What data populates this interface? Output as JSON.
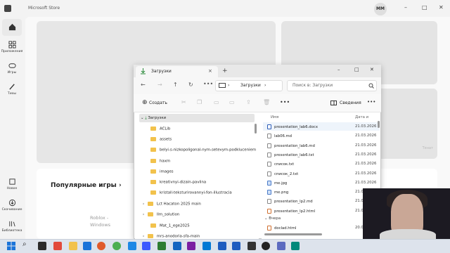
{
  "store": {
    "title": "Microsoft Store",
    "avatar": "MM",
    "nav": [
      {
        "label": "",
        "icon": "home-icon"
      },
      {
        "label": "Приложения",
        "icon": "apps-icon"
      },
      {
        "label": "Игры",
        "icon": "gamepad-icon"
      },
      {
        "label": "Тихы",
        "icon": "brush-icon"
      },
      {
        "label": "Новое",
        "icon": "bell-icon"
      },
      {
        "label": "Скачивание",
        "icon": "download-icon"
      },
      {
        "label": "Библиотека",
        "icon": "library-icon"
      }
    ],
    "games_title": "Популярные игры",
    "games_arrow": "›",
    "roblox": "Roblox -",
    "roblox2": "Windows",
    "hero_caption": "Тенат"
  },
  "explorer": {
    "tab": "Загрузки",
    "path": "Загрузки",
    "search": "Поиск в: Загрузки",
    "create": "Создать",
    "details": "Сведения",
    "tree_root": "Загрузки",
    "tree": [
      "ACLib",
      "assets",
      "belyi-s-nizkopoligonal-nym-setevym-podkluceniem",
      "haxm",
      "images",
      "kreativnyi-dizain-pavlina",
      "kristall-teksturirovannyi-fon-illustracia",
      "Lct Hacaton 2025 main",
      "llm_solution",
      "Mat_1_ege2025",
      "mrs-anodoria-sfa-main"
    ],
    "col_name": "Имя",
    "col_date": "Дата и",
    "files": [
      {
        "name": "presentation_lab6.docx",
        "date": "21.03.2026"
      },
      {
        "name": "lab06.md",
        "date": "21.03.2026"
      },
      {
        "name": "presentation_lab6.md",
        "date": "21.03.2026"
      },
      {
        "name": "presentation_lab6.txt",
        "date": "21.03.2026"
      },
      {
        "name": "список.txt",
        "date": "21.03.2026"
      },
      {
        "name": "список_2.txt",
        "date": "21.03.2026"
      },
      {
        "name": "me.jpg",
        "date": "21.03.2026"
      },
      {
        "name": "me.png",
        "date": "21.03.2026"
      },
      {
        "name": "presentation_lp2.md",
        "date": "21.03.2026"
      },
      {
        "name": "presentation_lp2.html",
        "date": "21.03.2026"
      }
    ],
    "group": "Вчера",
    "yesterday": [
      {
        "name": "doclad.html",
        "date": "20.03.2026"
      }
    ]
  }
}
